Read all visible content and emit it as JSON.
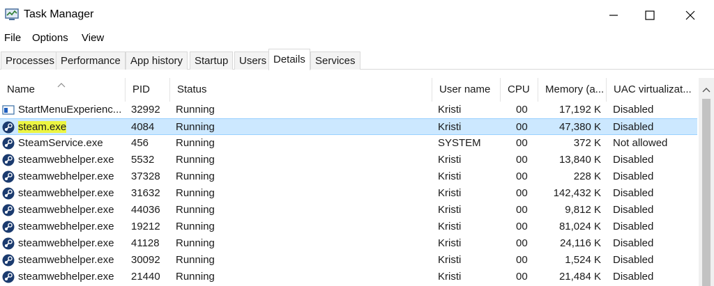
{
  "window": {
    "title": "Task Manager",
    "icon": "task-manager-icon",
    "controls": [
      "minimize-icon",
      "maximize-icon",
      "close-icon"
    ]
  },
  "menu": [
    "File",
    "Options",
    "View"
  ],
  "tabs": [
    {
      "label": "Processes",
      "active": false
    },
    {
      "label": "Performance",
      "active": false
    },
    {
      "label": "App history",
      "active": false
    },
    {
      "label": "Startup",
      "active": false
    },
    {
      "label": "Users",
      "active": false
    },
    {
      "label": "Details",
      "active": true
    },
    {
      "label": "Services",
      "active": false
    }
  ],
  "columns": [
    "Name",
    "PID",
    "Status",
    "User name",
    "CPU",
    "Memory (a...",
    "UAC virtualizat..."
  ],
  "sort": {
    "column": "Name",
    "direction": "ascending"
  },
  "rows": [
    {
      "name": "StartMenuExperienc...",
      "pid": "32992",
      "status": "Running",
      "user": "Kristi",
      "cpu": "00",
      "memory": "17,192 K",
      "uac": "Disabled",
      "icon": "start-menu-app-icon",
      "selected": false
    },
    {
      "name": "steam.exe",
      "pid": "4084",
      "status": "Running",
      "user": "Kristi",
      "cpu": "00",
      "memory": "47,380 K",
      "uac": "Disabled",
      "icon": "steam-icon",
      "selected": true
    },
    {
      "name": "SteamService.exe",
      "pid": "456",
      "status": "Running",
      "user": "SYSTEM",
      "cpu": "00",
      "memory": "372 K",
      "uac": "Not allowed",
      "icon": "steam-icon",
      "selected": false
    },
    {
      "name": "steamwebhelper.exe",
      "pid": "5532",
      "status": "Running",
      "user": "Kristi",
      "cpu": "00",
      "memory": "13,840 K",
      "uac": "Disabled",
      "icon": "steam-icon",
      "selected": false
    },
    {
      "name": "steamwebhelper.exe",
      "pid": "37328",
      "status": "Running",
      "user": "Kristi",
      "cpu": "00",
      "memory": "228 K",
      "uac": "Disabled",
      "icon": "steam-icon",
      "selected": false
    },
    {
      "name": "steamwebhelper.exe",
      "pid": "31632",
      "status": "Running",
      "user": "Kristi",
      "cpu": "00",
      "memory": "142,432 K",
      "uac": "Disabled",
      "icon": "steam-icon",
      "selected": false
    },
    {
      "name": "steamwebhelper.exe",
      "pid": "44036",
      "status": "Running",
      "user": "Kristi",
      "cpu": "00",
      "memory": "9,812 K",
      "uac": "Disabled",
      "icon": "steam-icon",
      "selected": false
    },
    {
      "name": "steamwebhelper.exe",
      "pid": "19212",
      "status": "Running",
      "user": "Kristi",
      "cpu": "00",
      "memory": "81,024 K",
      "uac": "Disabled",
      "icon": "steam-icon",
      "selected": false
    },
    {
      "name": "steamwebhelper.exe",
      "pid": "41128",
      "status": "Running",
      "user": "Kristi",
      "cpu": "00",
      "memory": "24,116 K",
      "uac": "Disabled",
      "icon": "steam-icon",
      "selected": false
    },
    {
      "name": "steamwebhelper.exe",
      "pid": "30092",
      "status": "Running",
      "user": "Kristi",
      "cpu": "00",
      "memory": "1,524 K",
      "uac": "Disabled",
      "icon": "steam-icon",
      "selected": false
    },
    {
      "name": "steamwebhelper.exe",
      "pid": "21440",
      "status": "Running",
      "user": "Kristi",
      "cpu": "00",
      "memory": "21,484 K",
      "uac": "Disabled",
      "icon": "steam-icon",
      "selected": false
    }
  ],
  "colors": {
    "selection": "#cce8ff",
    "selection_border": "#99d1ff",
    "name_highlight": "#ecf542",
    "steam_icon": "#1b3b6f"
  }
}
